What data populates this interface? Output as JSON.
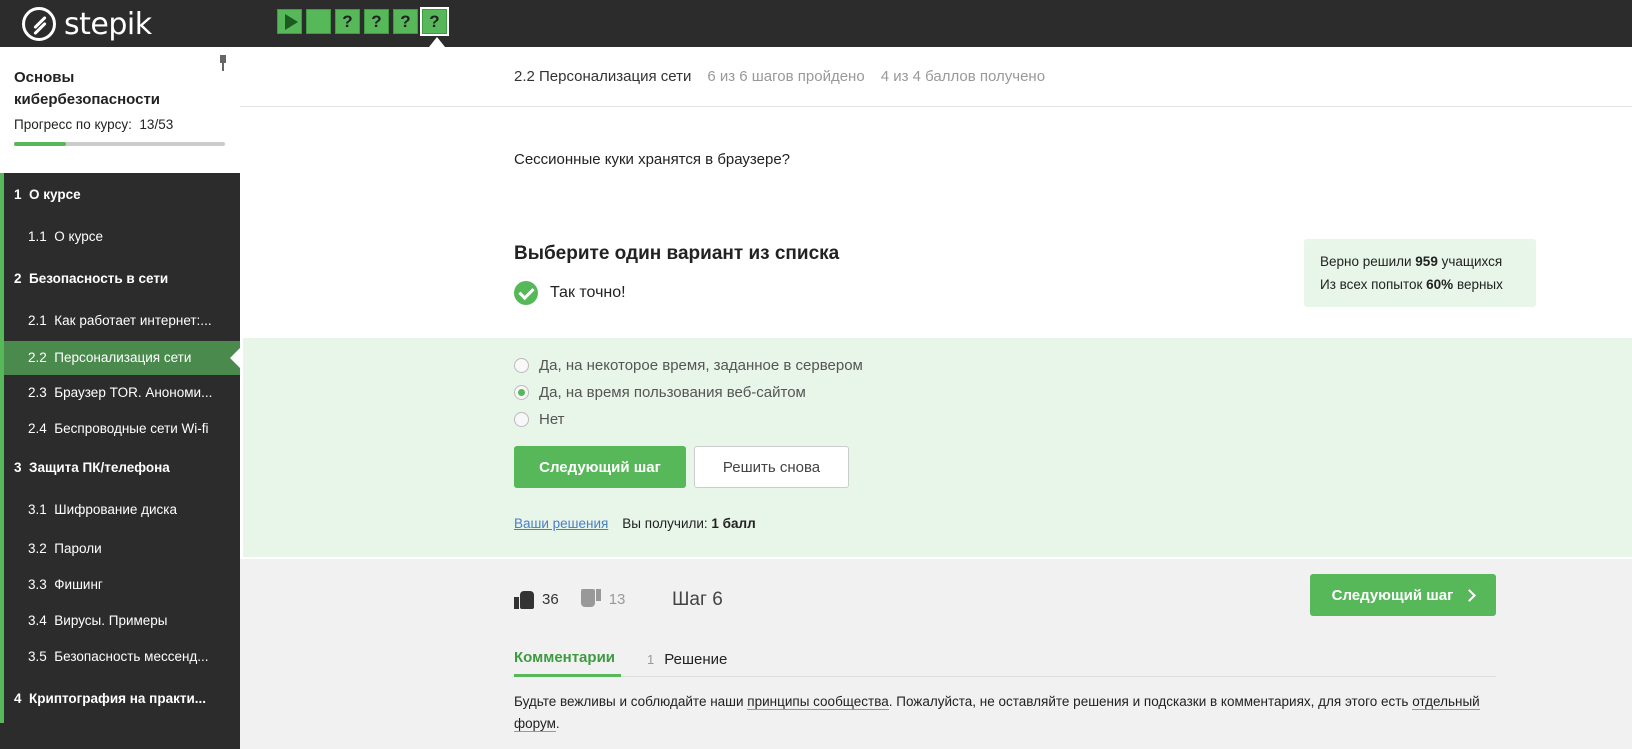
{
  "brand": {
    "name": "stepik"
  },
  "steps": [
    {
      "type": "video",
      "label": ""
    },
    {
      "type": "text",
      "label": ""
    },
    {
      "type": "quiz",
      "label": "?"
    },
    {
      "type": "quiz",
      "label": "?"
    },
    {
      "type": "quiz",
      "label": "?"
    },
    {
      "type": "quiz",
      "label": "?",
      "current": true
    }
  ],
  "sidebar": {
    "course_title": "Основы кибербезопасности",
    "progress_label": "Прогресс по курсу:",
    "progress_value": "13/53",
    "progress_fraction": 0.245,
    "sections": [
      {
        "num": "1",
        "title": "О курсе",
        "lessons": [
          {
            "num": "1.1",
            "title": "О курсе"
          }
        ]
      },
      {
        "num": "2",
        "title": "Безопасность в сети",
        "lessons": [
          {
            "num": "2.1",
            "title": "Как работает интернет:..."
          },
          {
            "num": "2.2",
            "title": "Персонализация сети",
            "active": true
          },
          {
            "num": "2.3",
            "title": "Браузер TOR. Анономи..."
          },
          {
            "num": "2.4",
            "title": "Беспроводные сети Wi-fi"
          }
        ]
      },
      {
        "num": "3",
        "title": "Защита ПК/телефона",
        "lessons": [
          {
            "num": "3.1",
            "title": "Шифрование диска"
          },
          {
            "num": "3.2",
            "title": "Пароли"
          },
          {
            "num": "3.3",
            "title": "Фишинг"
          },
          {
            "num": "3.4",
            "title": "Вирусы. Примеры"
          },
          {
            "num": "3.5",
            "title": "Безопасность мессенд..."
          }
        ]
      },
      {
        "num": "4",
        "title": "Криптография на практи...",
        "lessons": []
      }
    ]
  },
  "lesson": {
    "name": "2.2 Персонализация сети",
    "steps_done": "6 из 6 шагов пройдено",
    "points": "4 из 4 баллов  получено"
  },
  "quiz": {
    "question": "Сессионные куки хранятся в браузере?",
    "task_title": "Выберите один вариант из списка",
    "result": "Так точно!",
    "stats_line1_pre": "Верно решили ",
    "stats_line1_num": "959",
    "stats_line1_post": " учащихся",
    "stats_line2_pre": "Из всех попыток ",
    "stats_line2_num": "60%",
    "stats_line2_post": " верных",
    "options": [
      {
        "text": "Да, на некоторое время, заданное в сервером",
        "selected": false
      },
      {
        "text": "Да, на время пользования веб-сайтом",
        "selected": true
      },
      {
        "text": "Нет",
        "selected": false
      }
    ],
    "next_label": "Следующий шаг",
    "retry_label": "Решить снова",
    "your_solutions": "Ваши решения",
    "received_label": "Вы получили:",
    "received_value": "1 балл"
  },
  "footer": {
    "likes": "36",
    "dislikes": "13",
    "step_label": "Шаг 6",
    "next_label": "Следующий шаг",
    "tabs": [
      {
        "label": "Комментарии",
        "active": true,
        "count": ""
      },
      {
        "label": "Решение",
        "active": false,
        "count": "1"
      }
    ],
    "notice_1": "Будьте вежливы и соблюдайте наши ",
    "notice_link1": "принципы сообщества",
    "notice_2": ". Пожалуйста, не оставляйте решения и подсказки в комментариях, для этого есть ",
    "notice_link2": "отдельный форум",
    "notice_3": "."
  },
  "colors": {
    "accent": "#57b85a",
    "dark": "#2c2c2c",
    "success_bg": "#e8f5e9"
  }
}
